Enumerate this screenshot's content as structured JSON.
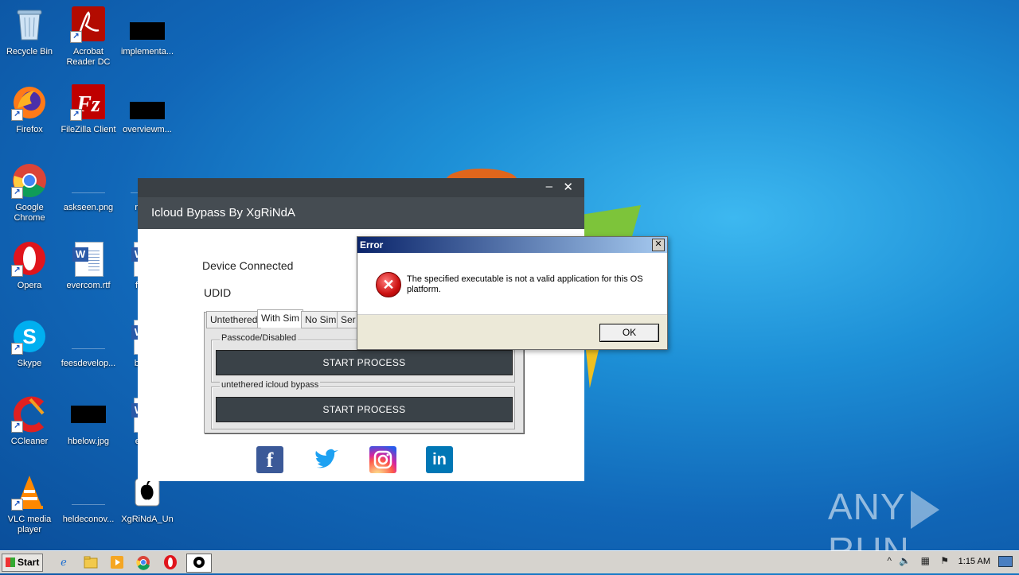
{
  "desktop": {
    "icons": [
      {
        "label": "Recycle Bin",
        "icon": "recycle-bin-icon"
      },
      {
        "label": "Acrobat Reader DC",
        "icon": "acrobat-icon"
      },
      {
        "label": "implementa...",
        "icon": "file-icon"
      },
      {
        "label": "Firefox",
        "icon": "firefox-icon"
      },
      {
        "label": "FileZilla Client",
        "icon": "filezilla-icon"
      },
      {
        "label": "overviewm...",
        "icon": "file-icon"
      },
      {
        "label": "Google Chrome",
        "icon": "chrome-icon"
      },
      {
        "label": "askseen.png",
        "icon": "image-file-icon"
      },
      {
        "label": "repo...",
        "icon": "file-icon"
      },
      {
        "label": "Opera",
        "icon": "opera-icon"
      },
      {
        "label": "evercom.rtf",
        "icon": "word-doc-icon"
      },
      {
        "label": "func...",
        "icon": "word-doc-icon"
      },
      {
        "label": "Skype",
        "icon": "skype-icon"
      },
      {
        "label": "feesdevelop...",
        "icon": "file-icon"
      },
      {
        "label": "bask...",
        "icon": "word-doc-icon"
      },
      {
        "label": "CCleaner",
        "icon": "ccleaner-icon"
      },
      {
        "label": "hbelow.jpg",
        "icon": "image-file-icon"
      },
      {
        "label": "eme...",
        "icon": "word-doc-icon"
      },
      {
        "label": "VLC media player",
        "icon": "vlc-icon"
      },
      {
        "label": "heldeconov...",
        "icon": "file-icon"
      },
      {
        "label": "XgRiNdA_Un",
        "icon": "apple-icon"
      }
    ]
  },
  "app": {
    "minimize_glyph": "–",
    "close_glyph": "✕",
    "title": "Icloud Bypass By XgRiNdA",
    "device_label": "Device Connected",
    "udid_label": "UDID",
    "tabs": [
      "Untethered",
      "With Sim",
      "No Sim",
      "Ser"
    ],
    "active_tab": "With Sim",
    "group1_title": "Passcode/Disabled",
    "group1_button": "START PROCESS",
    "group2_title": "untethered icloud bypass",
    "group2_button": "START PROCESS",
    "social": [
      {
        "name": "facebook",
        "glyph": "f",
        "color": "#3b5998"
      },
      {
        "name": "twitter",
        "glyph": "t",
        "color": "#1da1f2"
      },
      {
        "name": "instagram",
        "glyph": "◎",
        "color": "#d6249f"
      },
      {
        "name": "linkedin",
        "glyph": "in",
        "color": "#0077b5"
      }
    ]
  },
  "dialog": {
    "title": "Error",
    "close_glyph": "✕",
    "message": "The specified executable is not a valid application for this OS platform.",
    "ok_label": "OK"
  },
  "watermark": {
    "left": "ANY",
    "right": "RUN"
  },
  "taskbar": {
    "start_label": "Start",
    "pinned": [
      "ie-icon",
      "explorer-icon",
      "media-player-icon",
      "chrome-icon",
      "opera-icon",
      "xgrinda-app-icon"
    ],
    "clock": "1:15 AM",
    "tray_chevron": "^"
  }
}
